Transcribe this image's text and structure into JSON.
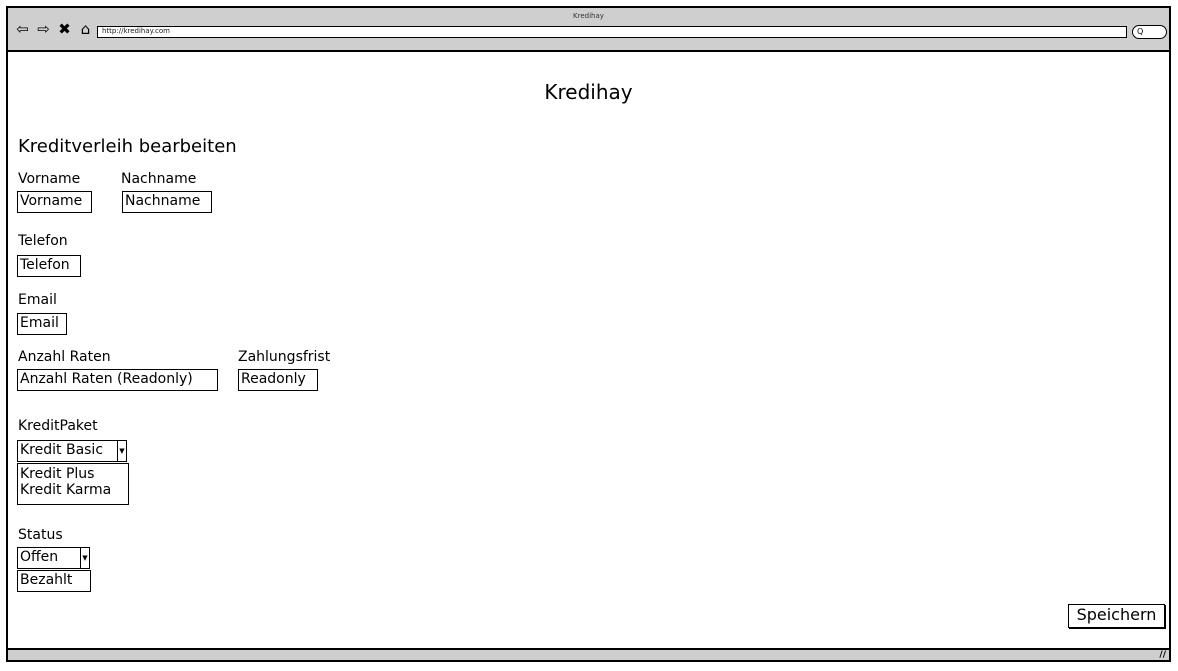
{
  "browser": {
    "window_title": "Kredihay",
    "url": "http://kredihay.com",
    "nav_icons": [
      "back-icon",
      "forward-icon",
      "stop-icon",
      "home-icon"
    ],
    "search_glyph": "Q"
  },
  "app": {
    "title": "Kredihay",
    "section_heading": "Kreditverleih bearbeiten"
  },
  "form": {
    "vorname": {
      "label": "Vorname",
      "value": "Vorname"
    },
    "nachname": {
      "label": "Nachname",
      "value": "Nachname"
    },
    "telefon": {
      "label": "Telefon",
      "value": "Telefon"
    },
    "email": {
      "label": "Email",
      "value": "Email"
    },
    "anzahl_raten": {
      "label": "Anzahl Raten",
      "value": "Anzahl Raten (Readonly)"
    },
    "zahlungsfrist": {
      "label": "Zahlungsfrist",
      "value": "Readonly"
    },
    "kreditpaket": {
      "label": "KreditPaket",
      "selected": "Kredit Basic",
      "options": [
        "Kredit Plus",
        "Kredit Karma"
      ]
    },
    "status": {
      "label": "Status",
      "selected": "Offen",
      "options": [
        "Bezahlt"
      ]
    },
    "save_label": "Speichern"
  }
}
